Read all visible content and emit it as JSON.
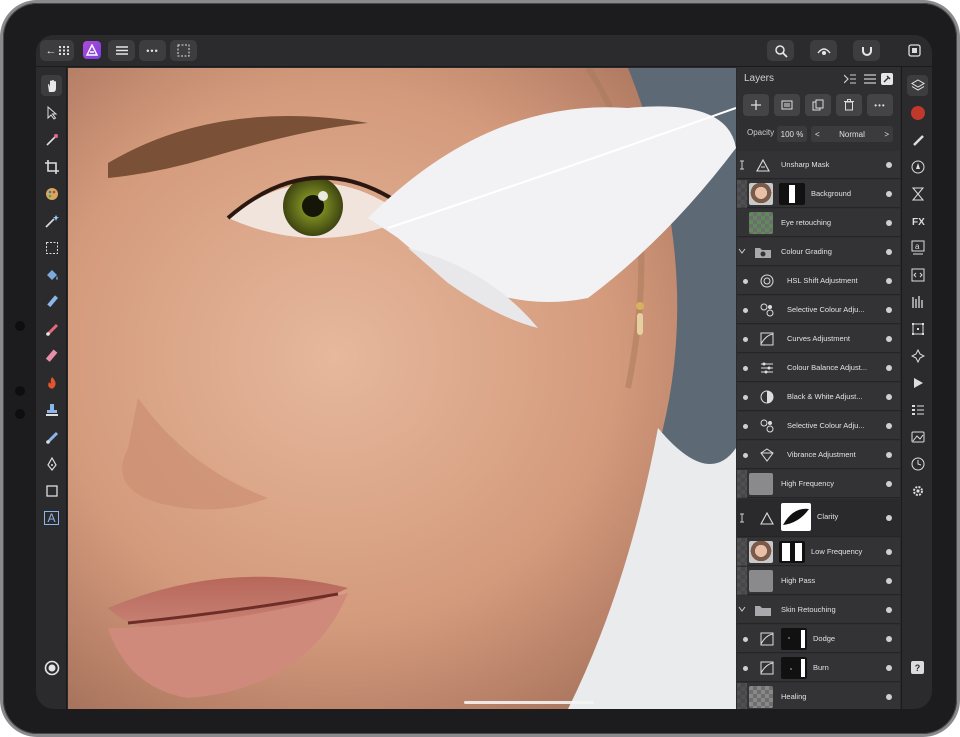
{
  "toolbar": {
    "back_label": "←",
    "more_label": "•••"
  },
  "layers_panel": {
    "title": "Layers",
    "opacity_label": "Opacity",
    "opacity_value": "100 %",
    "blend_mode": "Normal",
    "blend_prev": "<",
    "blend_next": ">",
    "layers": [
      {
        "name": "Unsharp Mask",
        "kind": "filter",
        "icon": "triangle-icon"
      },
      {
        "name": "Background",
        "kind": "pixel",
        "icon": "photo-thumb"
      },
      {
        "name": "Eye retouching",
        "kind": "pixel",
        "icon": "green-checker-thumb"
      },
      {
        "name": "Colour Grading",
        "kind": "group",
        "icon": "folder-icon"
      },
      {
        "name": "HSL Shift Adjustment",
        "kind": "adjustment",
        "icon": "hsl-icon"
      },
      {
        "name": "Selective Colour Adju...",
        "kind": "adjustment",
        "icon": "selective-colour-icon"
      },
      {
        "name": "Curves Adjustment",
        "kind": "adjustment",
        "icon": "curves-icon"
      },
      {
        "name": "Colour Balance Adjust...",
        "kind": "adjustment",
        "icon": "colour-balance-icon"
      },
      {
        "name": "Black & White Adjust...",
        "kind": "adjustment",
        "icon": "black-white-icon"
      },
      {
        "name": "Selective Colour Adju...",
        "kind": "adjustment",
        "icon": "selective-colour-icon"
      },
      {
        "name": "Vibrance Adjustment",
        "kind": "adjustment",
        "icon": "vibrance-icon"
      },
      {
        "name": "High Frequency",
        "kind": "pixel",
        "icon": "grey-thumb"
      },
      {
        "name": "Clarity",
        "kind": "filter",
        "icon": "triangle-icon"
      },
      {
        "name": "Low Frequency",
        "kind": "pixel",
        "icon": "photo-thumb"
      },
      {
        "name": "High Pass",
        "kind": "pixel",
        "icon": "grey-thumb"
      },
      {
        "name": "Skin Retouching",
        "kind": "group",
        "icon": "folder-icon"
      },
      {
        "name": "Dodge",
        "kind": "adjustment",
        "icon": "curves-icon"
      },
      {
        "name": "Burn",
        "kind": "adjustment",
        "icon": "curves-icon"
      },
      {
        "name": "Healing",
        "kind": "pixel",
        "icon": "checker-thumb"
      }
    ]
  },
  "colors": {
    "accent_persona": "#9b46dc",
    "record_red": "#c0392b",
    "panel_bg": "#2f2f31"
  },
  "help_label": "?",
  "type_tool_label": "A"
}
